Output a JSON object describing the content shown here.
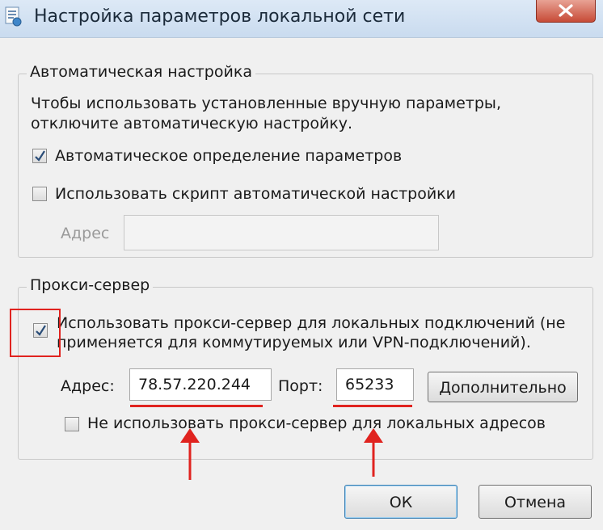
{
  "window": {
    "title": "Настройка параметров локальной сети"
  },
  "auto": {
    "legend": "Автоматическая настройка",
    "desc_line1": "Чтобы использовать установленные вручную параметры,",
    "desc_line2": "отключите автоматическую настройку.",
    "detect_label": "Автоматическое определение параметров",
    "detect_checked": true,
    "script_label": "Использовать скрипт автоматической настройки",
    "script_checked": false,
    "address_label": "Адрес",
    "address_value": ""
  },
  "proxy": {
    "legend": "Прокси-сервер",
    "use_label_line1": "Использовать прокси-сервер для локальных подключений (не",
    "use_label_line2": "применяется для коммутируемых или VPN-подключений).",
    "use_checked": true,
    "address_label": "Адрес:",
    "address_value": "78.57.220.244",
    "port_label": "Порт:",
    "port_value": "65233",
    "advanced_label": "Дополнительно",
    "bypass_label": "Не использовать прокси-сервер для локальных адресов",
    "bypass_checked": false
  },
  "buttons": {
    "ok_label": "ОК",
    "cancel_label": "Отмена"
  },
  "colors": {
    "annotation": "#e0231f",
    "titlebar": "#c9dbef",
    "close": "#c74b37"
  }
}
